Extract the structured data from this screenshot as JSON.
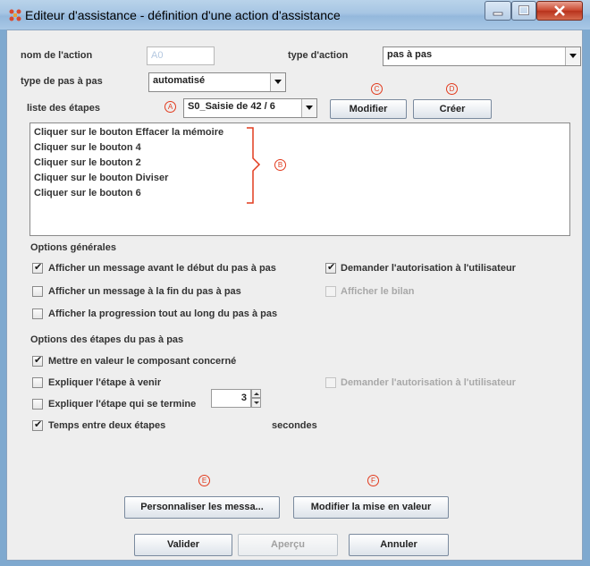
{
  "window": {
    "title": "Editeur d'assistance - définition d'une action d'assistance"
  },
  "form": {
    "nom_label": "nom de l'action",
    "nom_value": "A0",
    "type_action_label": "type d'action",
    "type_action_value": "pas à pas",
    "type_pas_label": "type de pas à pas",
    "type_pas_value": "automatisé",
    "liste_label": "liste des étapes",
    "liste_value": "S0_Saisie de 42 / 6"
  },
  "buttons": {
    "modifier": "Modifier",
    "creer": "Créer",
    "personnaliser": "Personnaliser les messa...",
    "modifier_mise": "Modifier la mise en valeur",
    "valider": "Valider",
    "apercu": "Aperçu",
    "annuler": "Annuler"
  },
  "markers": {
    "a": "A",
    "b": "B",
    "c": "C",
    "d": "D",
    "e": "E",
    "f": "F"
  },
  "steps": [
    "Cliquer sur le bouton Effacer la mémoire",
    "Cliquer sur le bouton 4",
    "Cliquer sur le bouton 2",
    "Cliquer sur le bouton Diviser",
    "Cliquer sur le bouton 6"
  ],
  "general": {
    "title": "Options générales",
    "opt1": {
      "label": "Afficher un message avant le début du pas à pas",
      "checked": true
    },
    "opt2": {
      "label": "Afficher un message à la fin du pas à pas",
      "checked": false
    },
    "opt3": {
      "label": "Afficher la progression tout au long du pas à pas",
      "checked": false
    },
    "opt4": {
      "label": "Demander l'autorisation à l'utilisateur",
      "checked": true
    },
    "opt5": {
      "label": "Afficher le bilan",
      "checked": false,
      "disabled": true
    }
  },
  "steps_options": {
    "title": "Options des étapes du pas à pas",
    "opt1": {
      "label": "Mettre en valeur le composant concerné",
      "checked": true
    },
    "opt2": {
      "label": "Expliquer l'étape à venir",
      "checked": false
    },
    "opt3": {
      "label": "Expliquer l'étape qui se termine",
      "checked": false
    },
    "opt4": {
      "label": "Temps entre deux étapes",
      "checked": true
    },
    "opt5": {
      "label": "Demander l'autorisation à l'utilisateur",
      "checked": false,
      "disabled": true
    },
    "delay_value": "3",
    "delay_unit": "secondes"
  },
  "colors": {
    "annotation": "#e23b1e",
    "titlebar": "#a6c5e3",
    "panel": "#eeeeee"
  }
}
